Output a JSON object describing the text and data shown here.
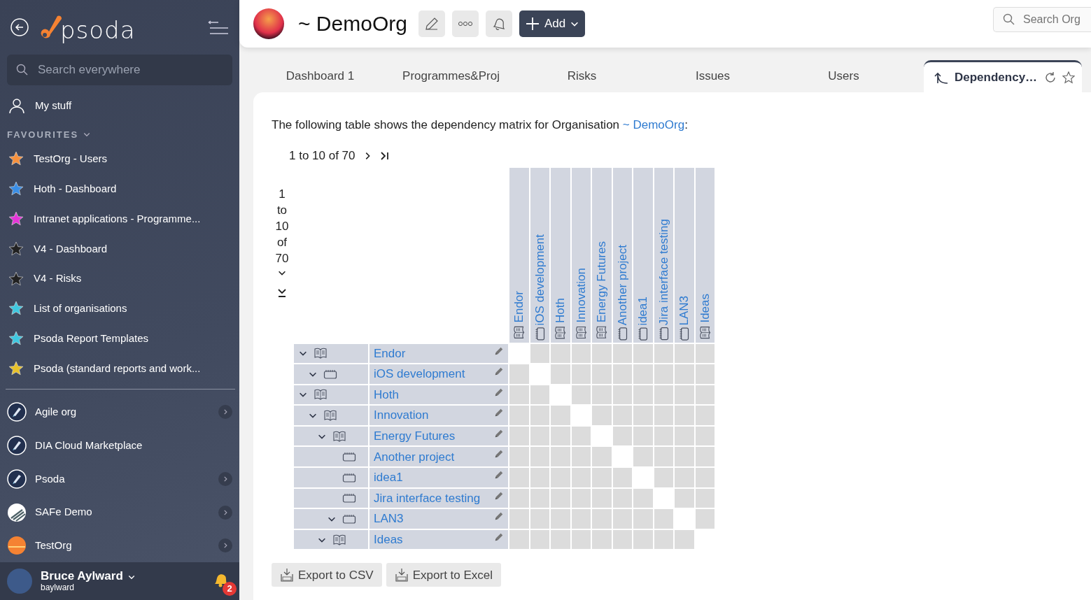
{
  "sidebar": {
    "logo_text": "psoda",
    "search": {
      "placeholder": "Search everywhere"
    },
    "my_stuff": "My stuff",
    "favourites_heading": "FAVOURITES",
    "favourites": [
      {
        "label": "TestOrg - Users",
        "color": "#f7913d"
      },
      {
        "label": "Hoth - Dashboard",
        "color": "#3a8ee6"
      },
      {
        "label": "Intranet applications - Programme...",
        "color": "#e535d8"
      },
      {
        "label": "V4 - Dashboard",
        "color": "#222222"
      },
      {
        "label": "V4 - Risks",
        "color": "#222222"
      },
      {
        "label": "List of organisations",
        "color": "#3fc8e0"
      },
      {
        "label": "Psoda Report Templates",
        "color": "#3fc8e0"
      },
      {
        "label": "Psoda (standard reports and work...",
        "color": "#e8c22a"
      }
    ],
    "organisations": [
      {
        "label": "Agile org",
        "kind": "rocket",
        "expandable": true
      },
      {
        "label": "DIA Cloud Marketplace",
        "kind": "rocket",
        "expandable": false
      },
      {
        "label": "Psoda",
        "kind": "rocket",
        "expandable": true
      },
      {
        "label": "SAFe Demo",
        "kind": "stripes",
        "expandable": true
      },
      {
        "label": "TestOrg",
        "kind": "sunset",
        "expandable": true
      }
    ],
    "user": {
      "name": "Bruce Aylward",
      "username": "baylward",
      "notifications": "2"
    }
  },
  "header": {
    "title": "~ DemoOrg",
    "add_button": "Add",
    "search": {
      "placeholder": "Search Org"
    }
  },
  "tabs": [
    {
      "label": "Dashboard 1",
      "selected": false
    },
    {
      "label": "Programmes&Proj",
      "selected": false
    },
    {
      "label": "Risks",
      "selected": false
    },
    {
      "label": "Issues",
      "selected": false
    },
    {
      "label": "Users",
      "selected": false
    },
    {
      "label": "Dependency…",
      "selected": true
    }
  ],
  "intro": {
    "text": "The following table shows the dependency matrix for Organisation",
    "link": "~ DemoOrg",
    "suffix": ":"
  },
  "pager": {
    "text": "1 to 10 of 70"
  },
  "vertical_pager": {
    "text": "1 to 10 of 70"
  },
  "matrix": {
    "columns": [
      {
        "label": "Endor",
        "kind": "programme"
      },
      {
        "label": "iOS development",
        "kind": "project"
      },
      {
        "label": "Hoth",
        "kind": "programme"
      },
      {
        "label": "Innovation",
        "kind": "programme"
      },
      {
        "label": "Energy Futures",
        "kind": "programme"
      },
      {
        "label": "Another project",
        "kind": "project"
      },
      {
        "label": "idea1",
        "kind": "project"
      },
      {
        "label": "Jira interface testing",
        "kind": "project"
      },
      {
        "label": "LAN3",
        "kind": "project"
      },
      {
        "label": "Ideas",
        "kind": "programme"
      }
    ],
    "rows": [
      {
        "label": "Endor",
        "kind": "programme",
        "expanded": true,
        "children": [
          {
            "label": "iOS development",
            "kind": "project",
            "expanded": true
          }
        ]
      },
      {
        "label": "Hoth",
        "kind": "programme",
        "expanded": true,
        "children": [
          {
            "label": "Innovation",
            "kind": "programme",
            "expanded": true,
            "children": [
              {
                "label": "Energy Futures",
                "kind": "programme",
                "expanded": true,
                "children": [
                  {
                    "label": "Another project",
                    "kind": "project"
                  },
                  {
                    "label": "idea1",
                    "kind": "project"
                  },
                  {
                    "label": "Jira interface testing",
                    "kind": "project"
                  },
                  {
                    "label": "LAN3",
                    "kind": "project",
                    "expanded": true
                  }
                ]
              },
              {
                "label": "Ideas",
                "kind": "programme",
                "expanded": true
              }
            ]
          }
        ]
      }
    ]
  },
  "export_buttons": [
    "Export to CSV",
    "Export to Excel"
  ]
}
